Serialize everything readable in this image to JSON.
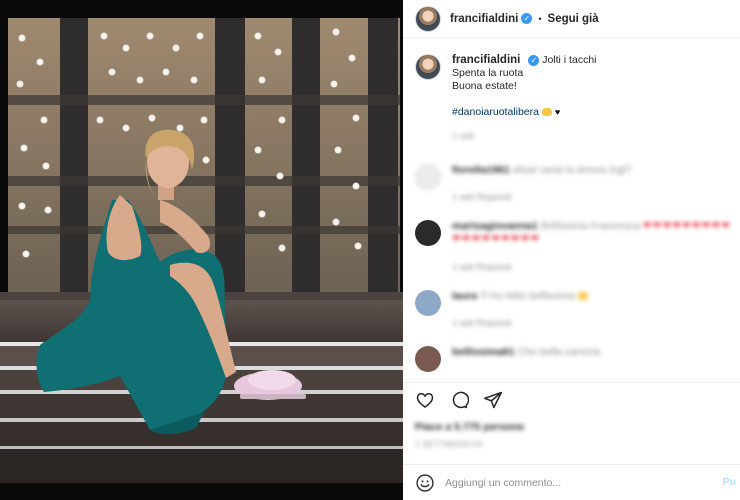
{
  "header": {
    "username": "francifialdini",
    "follow_label": "Segui già",
    "separator": "•"
  },
  "caption": {
    "username": "francifialdini",
    "lines": [
      "Jolti i tacchi",
      "Spenta la ruota",
      "Buona estate!"
    ],
    "hashtag": "#danoiaruotalibera",
    "time": "1 sett"
  },
  "comments": [
    {
      "username": "fiorella1961",
      "text": "elisa! sarai la donna ingl?",
      "meta": "1 sett   Rispondi",
      "avatar_color": "#ececec"
    },
    {
      "username": "marisagiovanna1",
      "text": "Bellissima Francesca",
      "hearts": "❤❤❤❤❤❤❤❤❤❤❤❤❤❤❤❤❤❤",
      "meta": "1 sett   Rispondi",
      "avatar_color": "#2a2a2a"
    },
    {
      "username": "laura",
      "text": "Ti ho fatto bellissima",
      "meta": "1 sett   Rispondi",
      "avatar_color": "#8ea9c7"
    },
    {
      "username": "bellissima61",
      "text": "Che bella camicia",
      "meta": "",
      "avatar_color": "#7a5a50"
    }
  ],
  "likes": "Piace a 5.775 persone",
  "date": "1 SETTIMANA FA",
  "add_comment": {
    "placeholder": "Aggiungi un commento...",
    "post_label": "Pu"
  },
  "icons": {
    "verified": "verified-badge-icon",
    "like": "heart-icon",
    "comment": "comment-icon",
    "share": "share-icon",
    "emoji": "emoji-icon"
  },
  "colors": {
    "link": "#00376b",
    "verified": "#3897f0",
    "muted": "#8e8e8e",
    "dress": "#0f6f72",
    "slipper": "#e7c7dd"
  }
}
